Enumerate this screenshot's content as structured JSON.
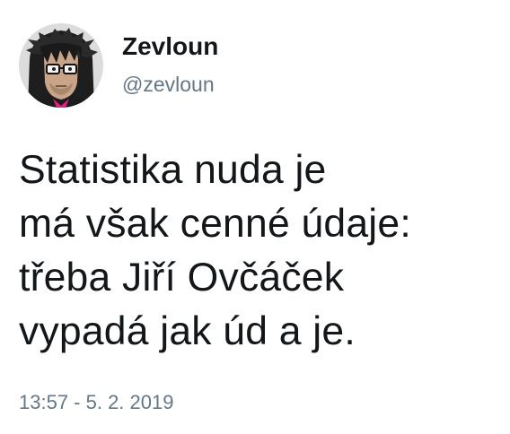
{
  "author": {
    "display_name": "Zevloun",
    "handle": "@zevloun",
    "avatar_icon": "cartoon-avatar-with-glasses"
  },
  "tweet": {
    "lines": [
      "Statistika nuda je",
      "má však cenné údaje:",
      "třeba Jiří Ovčáček",
      "vypadá jak úd a je."
    ],
    "timestamp": "13:57 - 5. 2. 2019"
  },
  "colors": {
    "text": "#14171a",
    "secondary": "#657786",
    "background": "#ffffff"
  }
}
